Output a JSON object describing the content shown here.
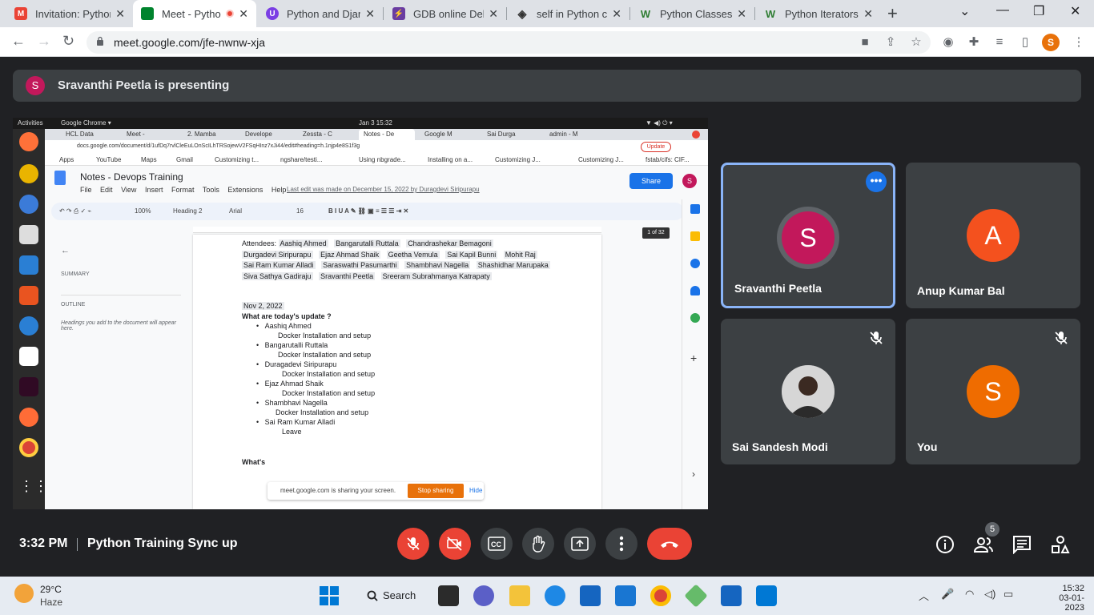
{
  "tabs": [
    {
      "title": "Invitation: Pythor",
      "favicon_color": "#ea4335",
      "favicon_letter": "M"
    },
    {
      "title": "Meet - Pytho",
      "favicon_color": "#00832d",
      "favicon_letter": "",
      "active": true
    },
    {
      "title": "Python and Djang",
      "favicon_color": "#7b3fe4",
      "favicon_letter": "U"
    },
    {
      "title": "GDB online Debu",
      "favicon_color": "#6a3ca1",
      "favicon_letter": "⚡"
    },
    {
      "title": "self in Python cla",
      "favicon_color": "#333333",
      "favicon_letter": "◈"
    },
    {
      "title": "Python Classes",
      "favicon_color": "#2e7d32",
      "favicon_letter": "W"
    },
    {
      "title": "Python Iterators",
      "favicon_color": "#2e7d32",
      "favicon_letter": "W"
    }
  ],
  "url": "meet.google.com/jfe-nwnw-xja",
  "profile_letter": "S",
  "presenting": {
    "avatar": "S",
    "text": "Sravanthi Peetla is presenting"
  },
  "shared": {
    "os_top": {
      "activities": "Activities",
      "app": "Google Chrome ▾",
      "datetime": "Jan 3  15:32"
    },
    "inner_tabs": [
      "HCL Data",
      "Meet -",
      "2. Mamba",
      "Develope",
      "Zessta - C",
      "Notes - De",
      "Google M",
      "Sai Durga",
      "admin - M"
    ],
    "inner_url": "docs.google.com/document/d/1ufDq7rvlCleEuLOnScILhTRSojewV2FSqHInz7xJi44/edit#heading=h.1njp4e8S1f3g",
    "bookmarks": [
      "Apps",
      "YouTube",
      "Maps",
      "Gmail",
      "Customizing t...",
      "ngshare/testi...",
      "Using nbgrade...",
      "Installing on a...",
      "Customizing J...",
      "Customizing J...",
      "fstab/cifs: CIF..."
    ],
    "doc_title": "Notes - Devops Training",
    "menu": [
      "File",
      "Edit",
      "View",
      "Insert",
      "Format",
      "Tools",
      "Extensions",
      "Help"
    ],
    "last_edit": "Last edit was made on December 15, 2022 by Duragdevi Siripurapu",
    "share_label": "Share",
    "update_label": "Update",
    "toolbar": {
      "zoom": "100%",
      "style": "Heading 2",
      "font": "Arial",
      "size": "16"
    },
    "outline": {
      "summary": "SUMMARY",
      "outline": "OUTLINE",
      "hint": "Headings you add to the document will appear here."
    },
    "page_indicator": "1 of 32",
    "attendees_label": "Attendees:",
    "attendees_rows": [
      [
        "Aashiq Ahmed",
        "Bangarutalli Ruttala",
        "Chandrashekar Bemagoni"
      ],
      [
        "Durgadevi Siripurapu",
        "Ejaz Ahmad Shaik",
        "Geetha Vemula",
        "Sai Kapil Bunni",
        "Mohit Raj"
      ],
      [
        "Sai Ram Kumar Alladi",
        "Saraswathi Pasumarthi",
        "Shambhavi Nagella",
        "Shashidhar Marupaka"
      ],
      [
        "Siva Sathya Gadiraju",
        "Sravanthi Peetla",
        "Sreeram Subrahmanya Katrapaty"
      ]
    ],
    "date": "Nov 2, 2022",
    "question": "What are today's update ?",
    "updates": [
      {
        "name": "Aashiq Ahmed",
        "note": "Docker Installation and setup"
      },
      {
        "name": "Bangarutalli Ruttala",
        "note": "Docker Installation and setup"
      },
      {
        "name": "Duragadevi Siripurapu",
        "note": "Docker Installation and setup"
      },
      {
        "name": "Ejaz Ahmad Shaik",
        "note": "Docker Installation and setup"
      },
      {
        "name": "Shambhavi Nagella",
        "note": "Docker Installation and setup"
      },
      {
        "name": "Sai Ram Kumar Alladi",
        "note": "Leave"
      }
    ],
    "whats": "What's",
    "sharing_msg": "meet.google.com is sharing your screen.",
    "stop_sharing": "Stop sharing",
    "hide": "Hide"
  },
  "participants": [
    {
      "name": "Sravanthi Peetla",
      "avatar": "S",
      "color": "#c2185b"
    },
    {
      "name": "Anup Kumar Bal",
      "avatar": "A",
      "color": "#f4511e"
    },
    {
      "name": "Sai Sandesh Modi",
      "avatar": "photo",
      "color": "#555555"
    },
    {
      "name": "You",
      "avatar": "S",
      "color": "#ef6c00"
    }
  ],
  "bottom": {
    "time": "3:32 PM",
    "meeting_name": "Python Training Sync up",
    "people_count": "5"
  },
  "taskbar": {
    "temp": "29°C",
    "weather": "Haze",
    "search": "Search",
    "time": "15:32",
    "date": "03-01-2023"
  }
}
